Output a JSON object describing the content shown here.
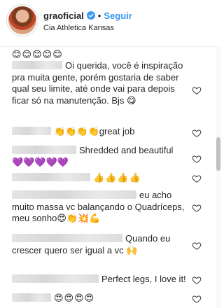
{
  "header": {
    "username": "graoficial",
    "separator": "•",
    "follow_label": "Seguir",
    "location": "Cia Athletica Kansas",
    "colors": {
      "link": "#3897f0",
      "verified": "#3897f0"
    }
  },
  "comments": [
    {
      "text": "😊😊😊😊😊",
      "has_name": false
    },
    {
      "text": "Oi querida, você é inspiração pra muita gente, porém gostaria de saber qual seu limite, até onde vai para depois ficar só na manutenção. Bjs 😋",
      "has_name": true
    },
    {
      "text": "👏👏👏👏great job",
      "has_name": true
    },
    {
      "text": "Shredded and beautiful 💜💜💜💜💜",
      "has_name": true
    },
    {
      "text": "👍👍👍👍",
      "has_name": true
    },
    {
      "text": "eu acho muito massa vc balançando o Quadríceps, meu sonho😍👏💥💪",
      "has_name": true
    },
    {
      "text": "Quando eu crescer quero ser igual a vc 🙌",
      "has_name": true
    },
    {
      "text": "Perfect legs, I love it!",
      "has_name": true
    },
    {
      "text": "😍😍😍😍",
      "has_name": true
    }
  ],
  "icons": {
    "heart": "heart-outline-icon",
    "verified": "verified-badge-icon"
  }
}
